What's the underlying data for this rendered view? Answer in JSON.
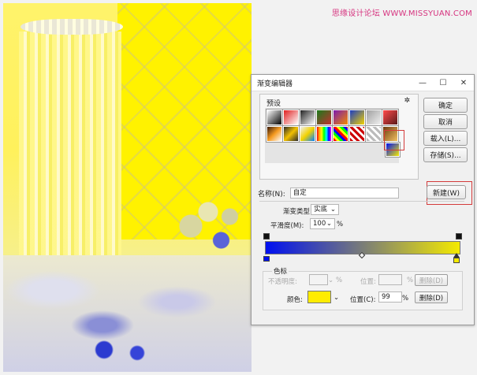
{
  "watermark": "思缘设计论坛 WWW.MISSYUAN.COM",
  "dialog": {
    "title": "渐变编辑器",
    "window_controls": {
      "minimize": "—",
      "maximize": "☐",
      "close": "✕"
    },
    "presets": {
      "label": "预设",
      "menu_icon": "gear-icon",
      "gear_glyph": "✲"
    },
    "buttons": {
      "ok": "确定",
      "cancel": "取消",
      "load": "载入(L)...",
      "save": "存储(S)...",
      "new": "新建(W)"
    },
    "name": {
      "label": "名称(N):",
      "value": "自定"
    },
    "gradient_type": {
      "label": "渐变类型:",
      "value": "实底",
      "arrow": "⌄"
    },
    "smoothness": {
      "label": "平滑度(M):",
      "value": "100",
      "unit": "%",
      "arrow": "⌄"
    },
    "gradient": {
      "start_color": "#0010f0",
      "end_color": "#f4ea00"
    },
    "color_stops": {
      "legend": "色标",
      "opacity_label": "不透明度:",
      "opacity_unit": "%",
      "opacity_arrow": "⌄",
      "opacity_position_label": "位置:",
      "opacity_position_unit": "%",
      "delete_label": "删除(D)",
      "color_label": "颜色:",
      "color_value": "#ffec00",
      "color_arrow": "⌄",
      "position_label": "位置(C):",
      "position_value": "99",
      "position_unit": "%",
      "delete_color_label": "删除(D)"
    }
  },
  "highlight_color": "#d43b3b"
}
